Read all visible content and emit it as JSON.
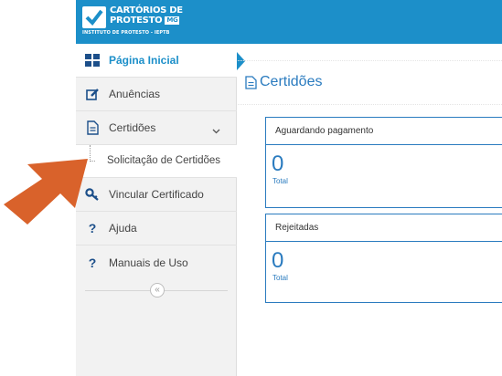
{
  "brand": {
    "line1": "CARTÓRIOS DE",
    "line2": "PROTESTO",
    "badge": "MG",
    "tagline": "INSTITUTO DE PROTESTO - IEPTB",
    "color": "#1c8fc9"
  },
  "sidebar": {
    "items": [
      {
        "label": "Página Inicial",
        "icon": "grid-icon",
        "active": true
      },
      {
        "label": "Anuências",
        "icon": "edit-icon"
      },
      {
        "label": "Certidões",
        "icon": "document-icon",
        "expanded": true,
        "subitems": [
          {
            "label": "Solicitação de Certidões"
          }
        ]
      },
      {
        "label": "Vincular Certificado",
        "icon": "key-icon"
      },
      {
        "label": "Ajuda",
        "icon": "question-icon"
      },
      {
        "label": "Manuais de Uso",
        "icon": "question-icon"
      }
    ],
    "collapse_glyph": "«"
  },
  "main": {
    "title": "Certidões",
    "cards": [
      {
        "header": "Aguardando pagamento",
        "value": "0",
        "caption": "Total"
      },
      {
        "header": "Rejeitadas",
        "value": "0",
        "caption": "Total"
      }
    ]
  },
  "colors": {
    "accent": "#2a7bbf",
    "annotation_arrow": "#d9622b"
  }
}
